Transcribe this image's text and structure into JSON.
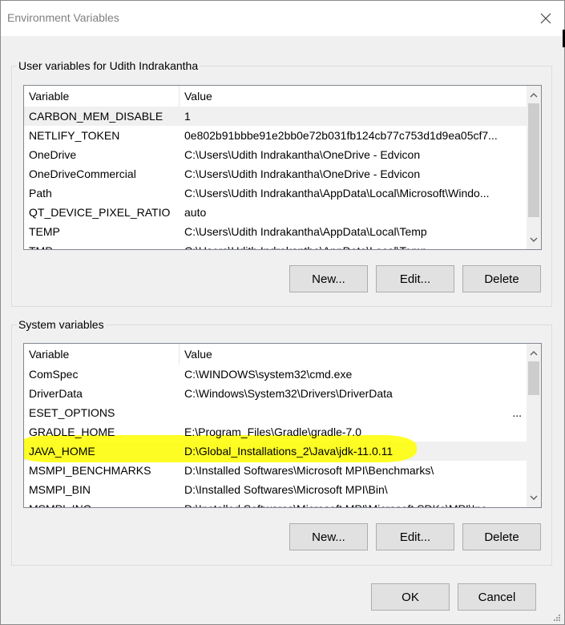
{
  "window": {
    "title": "Environment Variables",
    "close_icon": "close-icon"
  },
  "user_section": {
    "label": "User variables for Udith Indrakantha",
    "columns": [
      "Variable",
      "Value"
    ],
    "rows": [
      {
        "variable": "CARBON_MEM_DISABLE",
        "value": "1"
      },
      {
        "variable": "NETLIFY_TOKEN",
        "value": "0e802b91bbbe91e2bb0e72b031fb124cb77c753d1d9ea05cf7..."
      },
      {
        "variable": "OneDrive",
        "value": "C:\\Users\\Udith Indrakantha\\OneDrive - Edvicon"
      },
      {
        "variable": "OneDriveCommercial",
        "value": "C:\\Users\\Udith Indrakantha\\OneDrive - Edvicon"
      },
      {
        "variable": "Path",
        "value": "C:\\Users\\Udith Indrakantha\\AppData\\Local\\Microsoft\\Windo..."
      },
      {
        "variable": "QT_DEVICE_PIXEL_RATIO",
        "value": "auto"
      },
      {
        "variable": "TEMP",
        "value": "C:\\Users\\Udith Indrakantha\\AppData\\Local\\Temp"
      },
      {
        "variable": "TMP",
        "value": "C:\\Users\\Udith Indrakantha\\AppData\\Local\\Temp"
      }
    ],
    "selected_row": 0,
    "buttons": {
      "new": "New...",
      "edit": "Edit...",
      "delete": "Delete"
    }
  },
  "system_section": {
    "label": "System variables",
    "columns": [
      "Variable",
      "Value"
    ],
    "rows": [
      {
        "variable": "ComSpec",
        "value": "C:\\WINDOWS\\system32\\cmd.exe"
      },
      {
        "variable": "DriverData",
        "value": "C:\\Windows\\System32\\Drivers\\DriverData"
      },
      {
        "variable": "ESET_OPTIONS",
        "value": "..."
      },
      {
        "variable": "GRADLE_HOME",
        "value": "E:\\Program_Files\\Gradle\\gradle-7.0"
      },
      {
        "variable": "JAVA_HOME",
        "value": "D:\\Global_Installations_2\\Java\\jdk-11.0.11"
      },
      {
        "variable": "MSMPI_BENCHMARKS",
        "value": "D:\\Installed Softwares\\Microsoft MPI\\Benchmarks\\"
      },
      {
        "variable": "MSMPI_BIN",
        "value": "D:\\Installed Softwares\\Microsoft MPI\\Bin\\"
      },
      {
        "variable": "MSMPI_INC",
        "value": "D:\\Installed Softwares\\Microsoft MPI\\Microsoft SDKs\\MPI\\Inc"
      }
    ],
    "selected_row": 4,
    "highlighted_row": 4,
    "buttons": {
      "new": "New...",
      "edit": "Edit...",
      "delete": "Delete"
    }
  },
  "footer": {
    "ok": "OK",
    "cancel": "Cancel"
  },
  "colors": {
    "highlight": "#ffff00",
    "selection": "#f0f0f0",
    "dialog_bg": "#f0f0f0"
  }
}
